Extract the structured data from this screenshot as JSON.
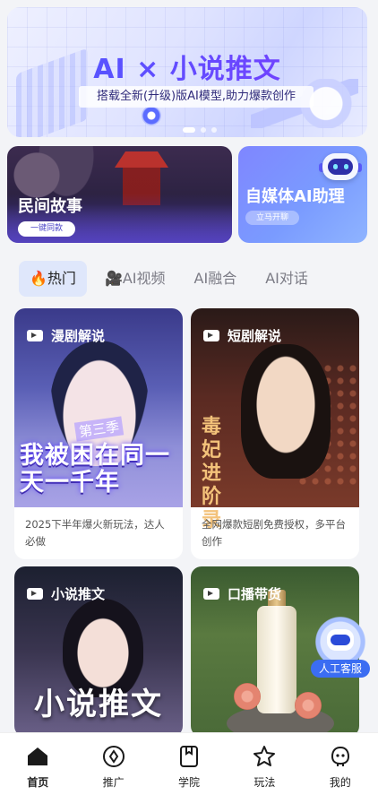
{
  "banner": {
    "title": "AI × 小说推文",
    "subtitle": "搭载全新(升级)版AI模型,助力爆款创作"
  },
  "features": {
    "folk": {
      "title": "民间故事",
      "button": "一键同款"
    },
    "ai_assistant": {
      "title": "自媒体AI助理",
      "button": "立马开聊"
    }
  },
  "tabs": [
    {
      "label": "🔥热门",
      "active": true
    },
    {
      "label": "🎥AI视频",
      "active": false
    },
    {
      "label": "AI融合",
      "active": false
    },
    {
      "label": "AI对话",
      "active": false
    }
  ],
  "cards": [
    {
      "tag": "漫剧解说",
      "image_text": "我被困在同一天一千年",
      "image_chip": "第三季",
      "desc": "2025下半年爆火新玩法，达人必做"
    },
    {
      "tag": "短剧解说",
      "image_text": "毒妃进阶录",
      "desc": "全网爆款短剧免费授权，多平台创作"
    },
    {
      "tag": "小说推文",
      "image_text": "小说推文"
    },
    {
      "tag": "口播带货"
    }
  ],
  "customer_service": {
    "label": "人工客服"
  },
  "nav": [
    {
      "label": "首页",
      "icon": "home-icon",
      "active": true
    },
    {
      "label": "推广",
      "icon": "compass-icon",
      "active": false
    },
    {
      "label": "学院",
      "icon": "book-icon",
      "active": false
    },
    {
      "label": "玩法",
      "icon": "star-icon",
      "active": false
    },
    {
      "label": "我的",
      "icon": "profile-icon",
      "active": false
    }
  ],
  "colors": {
    "accent": "#3b6df2",
    "tab_active_bg": "#dfe7fb"
  }
}
